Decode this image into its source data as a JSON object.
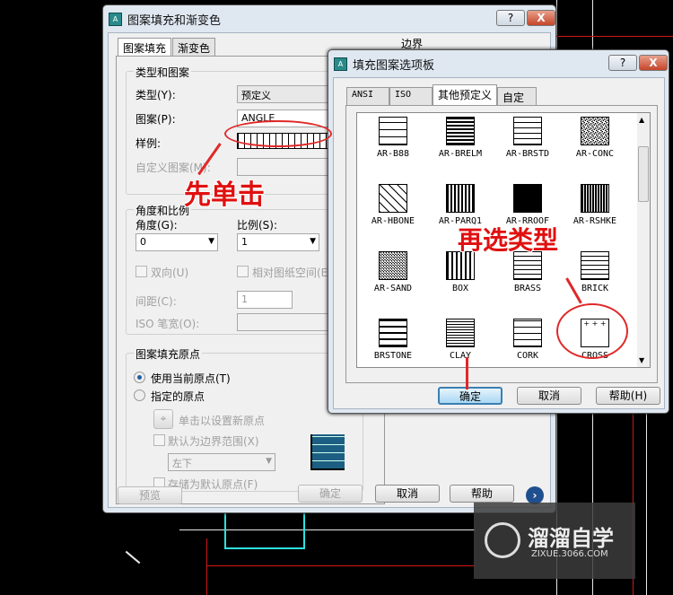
{
  "main_dialog": {
    "title": "图案填充和渐变色",
    "help_btn": "?",
    "close_btn": "X",
    "tabs": [
      "图案填充",
      "渐变色"
    ],
    "boundary_label": "边界",
    "type_group": {
      "label": "类型和图案",
      "type_label": "类型(Y):",
      "type_value": "预定义",
      "pattern_label": "图案(P):",
      "pattern_value": "ANGLE",
      "sample_label": "样例:",
      "custom_label": "自定义图案(M):"
    },
    "angle_group": {
      "label": "角度和比例",
      "angle_label": "角度(G):",
      "angle_value": "0",
      "scale_label": "比例(S):",
      "scale_value": "1",
      "double_label": "双向(U)",
      "relative_label": "相对图纸空间(E)",
      "spacing_label": "间距(C):",
      "spacing_value": "1",
      "iso_label": "ISO 笔宽(O):"
    },
    "origin_group": {
      "label": "图案填充原点",
      "use_current": "使用当前原点(T)",
      "specified": "指定的原点",
      "click_set": "单击以设置新原点",
      "default_boundary": "默认为边界范围(X)",
      "position_value": "左下",
      "store_default": "存储为默认原点(F)"
    },
    "buttons": {
      "preview": "预览",
      "ok": "确定",
      "cancel": "取消",
      "help": "帮助"
    }
  },
  "palette_dialog": {
    "title": "填充图案选项板",
    "help_btn": "?",
    "close_btn": "X",
    "tabs": [
      "ANSI",
      "ISO",
      "其他预定义",
      "自定义"
    ],
    "active_tab": "其他预定义",
    "patterns": [
      "AR-B88",
      "AR-BRELM",
      "AR-BRSTD",
      "AR-CONC",
      "AR-HBONE",
      "AR-PARQ1",
      "AR-RROOF",
      "AR-RSHKE",
      "AR-SAND",
      "BOX",
      "BRASS",
      "BRICK",
      "BRSTONE",
      "CLAY",
      "CORK",
      "CROSS"
    ],
    "buttons": {
      "ok": "确定",
      "cancel": "取消",
      "help": "帮助(H)"
    }
  },
  "annotations": {
    "first": "先单击",
    "second": "再选类型"
  },
  "watermark": {
    "brand": "溜溜自学",
    "url": "ZIXUE.3066.COM"
  },
  "colors": {
    "annotation": "#e01010",
    "default_button": "#3c7fb1"
  }
}
